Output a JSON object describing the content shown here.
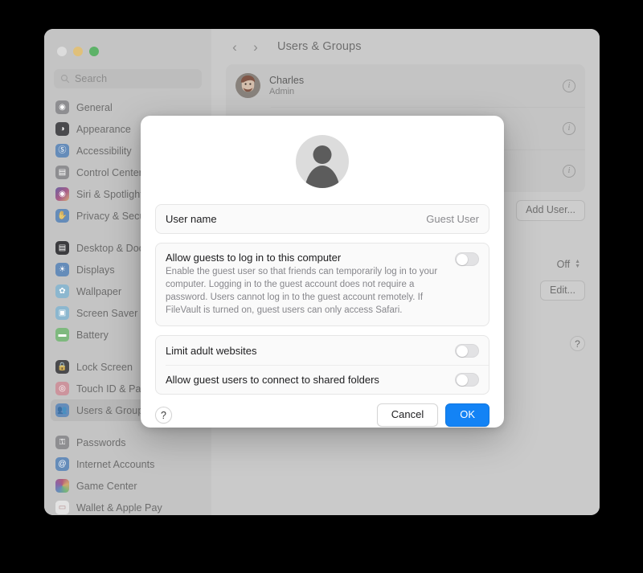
{
  "window": {
    "traffic_lights": [
      "close",
      "minimize",
      "zoom"
    ],
    "search_placeholder": "Search",
    "toolbar_title": "Users & Groups",
    "back_icon": "chevron-left-icon",
    "forward_icon": "chevron-right-icon"
  },
  "sidebar": {
    "groups": [
      {
        "items": [
          {
            "label": "General",
            "icon": "gear-icon",
            "color": "#8e8e93",
            "glyph": "⚙",
            "selected": false
          },
          {
            "label": "Appearance",
            "icon": "appearance-icon",
            "color": "#4a4a4f",
            "glyph": "◑",
            "selected": false
          },
          {
            "label": "Accessibility",
            "icon": "accessibility-icon",
            "color": "#4a90e2",
            "glyph": "Ⓐ",
            "selected": false
          },
          {
            "label": "Control Center",
            "icon": "control-center-icon",
            "color": "#8e8e93",
            "glyph": "☰",
            "selected": false
          },
          {
            "label": "Siri & Spotlight",
            "icon": "siri-icon",
            "color": "#c2477f",
            "glyph": "◉",
            "selected": false
          },
          {
            "label": "Privacy & Security",
            "icon": "privacy-icon",
            "color": "#4a90e2",
            "glyph": "✋",
            "selected": false
          }
        ]
      },
      {
        "items": [
          {
            "label": "Desktop & Dock",
            "icon": "desktop-dock-icon",
            "color": "#3c3c41",
            "glyph": "▤",
            "selected": false
          },
          {
            "label": "Displays",
            "icon": "displays-icon",
            "color": "#4a90e2",
            "glyph": "☀",
            "selected": false
          },
          {
            "label": "Wallpaper",
            "icon": "wallpaper-icon",
            "color": "#6fbde8",
            "glyph": "✿",
            "selected": false
          },
          {
            "label": "Screen Saver",
            "icon": "screen-saver-icon",
            "color": "#6fbde8",
            "glyph": "▣",
            "selected": false
          },
          {
            "label": "Battery",
            "icon": "battery-icon",
            "color": "#5bc75b",
            "glyph": "▬",
            "selected": false
          }
        ]
      },
      {
        "items": [
          {
            "label": "Lock Screen",
            "icon": "lock-screen-icon",
            "color": "#4a4a4f",
            "glyph": "ὑ2",
            "selected": false
          },
          {
            "label": "Touch ID & Password",
            "icon": "touch-id-icon",
            "color": "#f08a9a",
            "glyph": "◎",
            "selected": false
          },
          {
            "label": "Users & Groups",
            "icon": "users-groups-icon",
            "color": "#4a90e2",
            "glyph": "὆5",
            "selected": true
          }
        ]
      },
      {
        "items": [
          {
            "label": "Passwords",
            "icon": "passwords-icon",
            "color": "#8e8e93",
            "glyph": "⚿",
            "selected": false
          },
          {
            "label": "Internet Accounts",
            "icon": "internet-accounts-icon",
            "color": "#4a90e2",
            "glyph": "@",
            "selected": false
          },
          {
            "label": "Game Center",
            "icon": "game-center-icon",
            "color": "#d05ba8",
            "glyph": "⬤",
            "selected": false
          },
          {
            "label": "Wallet & Apple Pay",
            "icon": "wallet-icon",
            "color": "#e0e0e0",
            "glyph": "▭",
            "selected": false
          }
        ]
      }
    ]
  },
  "main": {
    "users": [
      {
        "name": "Charles",
        "role": "Admin",
        "info_label": "i"
      },
      {
        "name": "",
        "role": "",
        "info_label": "i"
      },
      {
        "name": "",
        "role": "",
        "info_label": "i"
      }
    ],
    "add_user_label": "Add User...",
    "automatic_login_value": "Off",
    "edit_label": "Edit...",
    "help_label": "?"
  },
  "sheet": {
    "avatar_icon": "person-placeholder-icon",
    "username_row": {
      "key": "User name",
      "value": "Guest User"
    },
    "settings": [
      {
        "title": "Allow guests to log in to this computer",
        "description": "Enable the guest user so that friends can temporarily log in to your computer. Logging in to the guest account does not require a password. Users cannot log in to the guest account remotely. If FileVault is turned on, guest users can only access Safari.",
        "toggle_on": false
      },
      {
        "title": "Limit adult websites",
        "description": "",
        "toggle_on": false
      },
      {
        "title": "Allow guest users to connect to shared folders",
        "description": "",
        "toggle_on": false
      }
    ],
    "help_label": "?",
    "cancel_label": "Cancel",
    "ok_label": "OK",
    "accent_color": "#1383f5"
  }
}
